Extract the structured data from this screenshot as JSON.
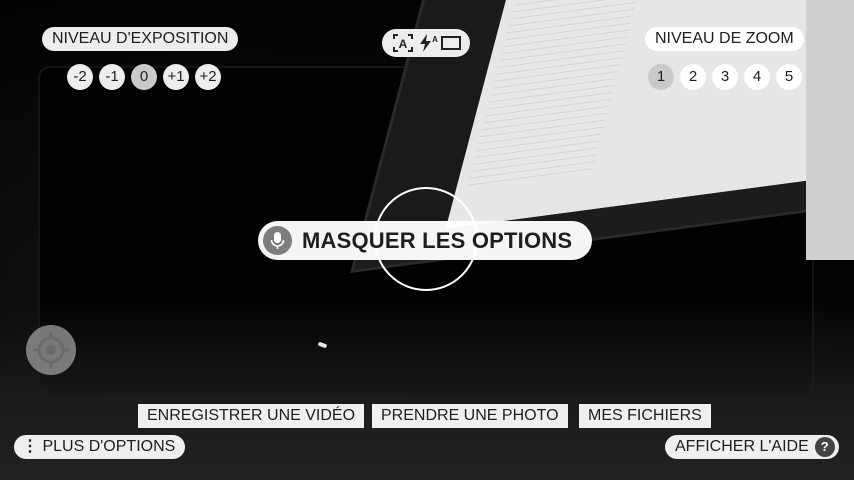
{
  "exposure": {
    "title": "NIVEAU D'EXPOSITION",
    "levels": [
      "-2",
      "-1",
      "0",
      "+1",
      "+2"
    ],
    "selected": "0"
  },
  "zoom": {
    "title": "NIVEAU DE ZOOM",
    "levels": [
      "1",
      "2",
      "3",
      "4",
      "5"
    ],
    "selected": "1"
  },
  "mode_icons": [
    "auto-text-mode-icon",
    "auto-flash-icon",
    "aspect-ratio-icon"
  ],
  "center": {
    "hide_options_label": "MASQUER LES OPTIONS"
  },
  "bottom_bar": {
    "record_video": "ENREGISTRER UNE VIDÉO",
    "take_photo": "PRENDRE UNE PHOTO",
    "my_files": "MES FICHIERS",
    "more_options": "PLUS D'OPTIONS",
    "show_help": "AFFICHER L'AIDE",
    "help_badge": "?"
  },
  "colors": {
    "pill_bg": "#ffffff",
    "text": "#1e1e1e",
    "selected_bg": "#c9c9c9"
  }
}
